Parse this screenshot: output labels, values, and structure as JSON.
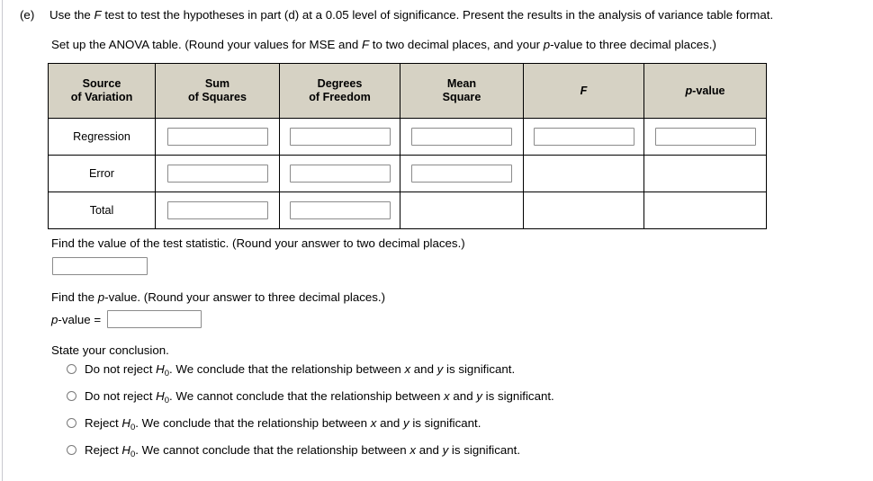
{
  "question": {
    "label": "(e)",
    "text_before_F": "Use the ",
    "text_F": "F",
    "text_after_F": " test to test the hypotheses in part (d) at a 0.05 level of significance. Present the results in the analysis of variance table format.",
    "subprompt_part1": "Set up the ANOVA table. (Round your values for MSE and ",
    "subprompt_F": "F",
    "subprompt_part2": " to two decimal places, and your ",
    "subprompt_p": "p",
    "subprompt_part3": "-value to three decimal places.)"
  },
  "anova_table": {
    "headers": [
      {
        "line1": "Source",
        "line2": "of Variation"
      },
      {
        "line1": "Sum",
        "line2": "of Squares"
      },
      {
        "line1": "Degrees",
        "line2": "of Freedom"
      },
      {
        "line1": "Mean",
        "line2": "Square"
      },
      {
        "line1": "F",
        "line2": "",
        "italic": true
      },
      {
        "line1": "p-value",
        "line2": "",
        "italic_prefix": "p"
      }
    ],
    "rows": [
      {
        "label": "Regression",
        "inputs": [
          "",
          "",
          "",
          "",
          ""
        ],
        "input_count": 5
      },
      {
        "label": "Error",
        "inputs": [
          "",
          "",
          ""
        ],
        "input_count": 3
      },
      {
        "label": "Total",
        "inputs": [
          "",
          ""
        ],
        "input_count": 2
      }
    ],
    "header_bg": "#d6d2c4",
    "border_color": "#000000",
    "input_border": "#8b8b8b"
  },
  "test_statistic": {
    "prompt": "Find the value of the test statistic. (Round your answer to two decimal places.)",
    "value": "",
    "placeholder": ""
  },
  "p_value_section": {
    "prompt_part1": "Find the ",
    "prompt_p": "p",
    "prompt_part2": "-value. (Round your answer to three decimal places.)",
    "field_label_p": "p",
    "field_label_rest": "-value =",
    "value": "",
    "placeholder": ""
  },
  "conclusion": {
    "prompt": "State your conclusion.",
    "options": [
      {
        "decision_prefix": "Do not reject ",
        "decision_H": "H",
        "decision_sub": "0",
        "rest_a": ". We conclude that the relationship between ",
        "var_x": "x",
        "rest_b": " and ",
        "var_y": "y",
        "rest_c": " is significant.",
        "selected": false
      },
      {
        "decision_prefix": "Do not reject ",
        "decision_H": "H",
        "decision_sub": "0",
        "rest_a": ". We cannot conclude that the relationship between ",
        "var_x": "x",
        "rest_b": " and ",
        "var_y": "y",
        "rest_c": " is significant.",
        "selected": false
      },
      {
        "decision_prefix": "Reject ",
        "decision_H": "H",
        "decision_sub": "0",
        "rest_a": ". We conclude that the relationship between ",
        "var_x": "x",
        "rest_b": " and ",
        "var_y": "y",
        "rest_c": " is significant.",
        "selected": false
      },
      {
        "decision_prefix": "Reject ",
        "decision_H": "H",
        "decision_sub": "0",
        "rest_a": ". We cannot conclude that the relationship between ",
        "var_x": "x",
        "rest_b": " and ",
        "var_y": "y",
        "rest_c": " is significant.",
        "selected": false
      }
    ]
  }
}
